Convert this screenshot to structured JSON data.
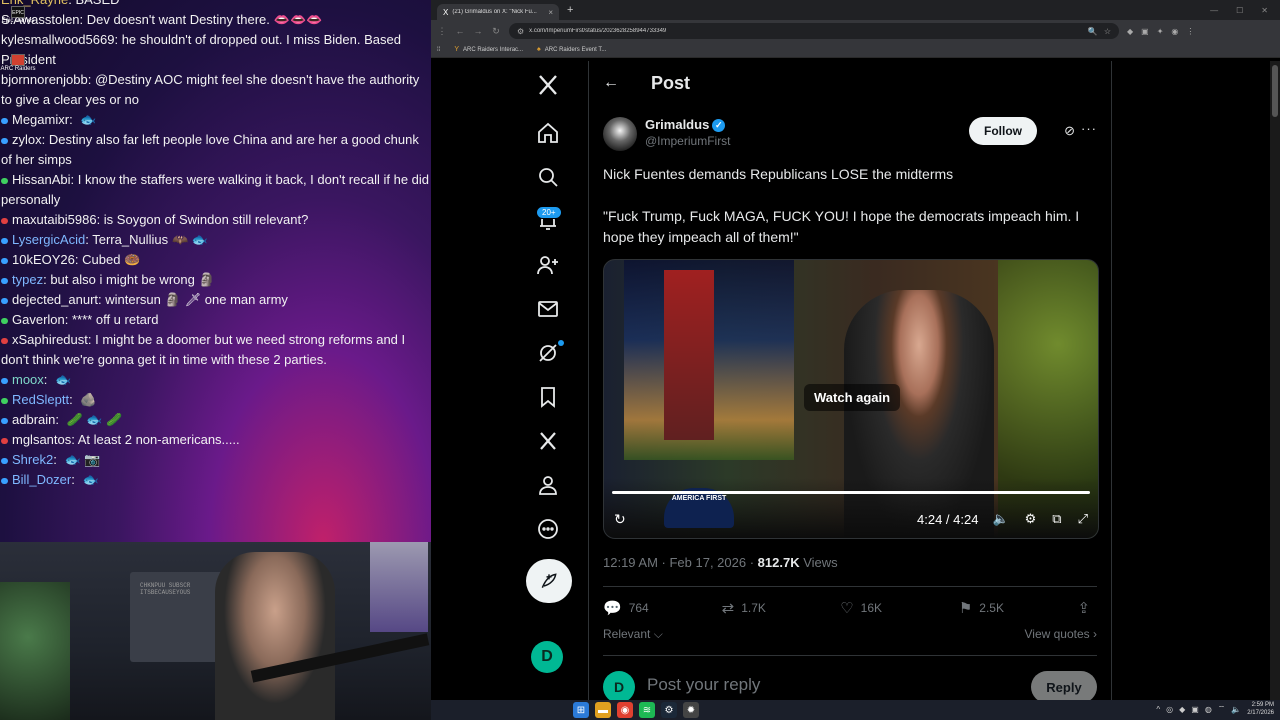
{
  "chat": {
    "desktop_icons": [
      "Epic Games",
      "ARC Raiders"
    ],
    "lines": [
      {
        "user": "Erik_Rayne",
        "sep": ": ",
        "msg": "BASED",
        "color": "#e0c060",
        "badge": "",
        "emote": ""
      },
      {
        "user": "S.Awasstolen",
        "sep": ": ",
        "msg": "Dev doesn't want Destiny there.",
        "color": "#f2f2f2",
        "badge": "",
        "emote": "👄👄👄"
      },
      {
        "user": "kylesmallwood5669",
        "sep": ": ",
        "msg": "he shouldn't of dropped out. I miss Biden. Based President",
        "color": "#f2f2f2",
        "badge": "",
        "emote": ""
      },
      {
        "user": "bjornnorenjobb",
        "sep": ": ",
        "msg": "@Destiny AOC might feel she doesn't have the authority to give a clear yes or no",
        "color": "#f2f2f2",
        "badge": "",
        "emote": ""
      },
      {
        "user": "Megamixr",
        "sep": ": ",
        "msg": "",
        "color": "#f2f2f2",
        "badge": "#39a0ff",
        "emote": "🐟"
      },
      {
        "user": "zylox",
        "sep": ": ",
        "msg": "Destiny also far left people love China and are her a good chunk of her simps",
        "color": "#f2f2f2",
        "badge": "#39a0ff",
        "emote": ""
      },
      {
        "user": "HissanAbi",
        "sep": ": ",
        "msg": "I know the staffers were walking it back, I don't recall if he did personally",
        "color": "#f2f2f2",
        "badge": "#3fd060",
        "emote": ""
      },
      {
        "user": "maxutaibi5986",
        "sep": ": ",
        "msg": "is Soygon of Swindon still relevant?",
        "color": "#f2f2f2",
        "badge": "#e04040",
        "emote": ""
      },
      {
        "user": "LysergicAcid",
        "sep": ": ",
        "msg": "Terra_Nullius",
        "color": "#7fb8ff",
        "badge": "#39a0ff",
        "emote": "🦇 🐟"
      },
      {
        "user": "10kEOY26",
        "sep": ": ",
        "msg": "Cubed",
        "color": "#f2f2f2",
        "badge": "#39a0ff",
        "emote": "🍩"
      },
      {
        "user": "typez",
        "sep": ": ",
        "msg": "but also i might be wrong",
        "color": "#7fb8ff",
        "badge": "#39a0ff",
        "emote": "🗿"
      },
      {
        "user": "dejected_anurt",
        "sep": ": ",
        "msg": "wintersun",
        "color": "#f2f2f2",
        "badge": "#39a0ff",
        "emote": "🗿 🗡 one man army"
      },
      {
        "user": "Gaverlon",
        "sep": ": ",
        "msg": "**** off u retard",
        "color": "#f2f2f2",
        "badge": "#3fd060",
        "emote": ""
      },
      {
        "user": "xSaphiredust",
        "sep": ": ",
        "msg": "I might be a doomer but we need strong reforms and I don't think we're gonna get it in time with these 2 parties.",
        "color": "#f2f2f2",
        "badge": "#e04040",
        "emote": ""
      },
      {
        "user": "moox",
        "sep": ": ",
        "msg": "",
        "color": "#7fd8c8",
        "badge": "#39a0ff",
        "emote": "🐟"
      },
      {
        "user": "RedSleptt",
        "sep": ": ",
        "msg": "",
        "color": "#7fb8ff",
        "badge": "#3fd060",
        "emote": "🪨"
      },
      {
        "user": "adbrain",
        "sep": ": ",
        "msg": "",
        "color": "#f2f2f2",
        "badge": "#39a0ff",
        "emote": "🥒 🐟 🥒"
      },
      {
        "user": "mglsantos",
        "sep": ": ",
        "msg": "At least 2 non-americans.....",
        "color": "#f2f2f2",
        "badge": "#e04040",
        "emote": ""
      },
      {
        "user": "Shrek2",
        "sep": ": ",
        "msg": "",
        "color": "#7fb8ff",
        "badge": "#39a0ff",
        "emote": "🐟 📷"
      },
      {
        "user": "Bill_Dozer",
        "sep": ": ",
        "msg": "",
        "color": "#7fb8ff",
        "badge": "#39a0ff",
        "emote": "🐟"
      }
    ]
  },
  "webcam": {
    "wall_text": "CHKNPUU SUBSCR\nITSBECAUSEYOUS"
  },
  "browser": {
    "tab_title": "(21) Grimaldus on X: \"Nick Fu...",
    "tab_favicon": "X",
    "new_tab": "+",
    "url": "x.com/ImperiumFirst/status/2023628258944733349",
    "bookmarks": [
      "ARC Raiders Interac...",
      "ARC Raiders Event T..."
    ]
  },
  "xnav": {
    "items": [
      "x-logo-icon",
      "home-icon",
      "explore-icon",
      "notifications-icon",
      "follow-icon",
      "messages-icon",
      "grok-icon",
      "bookmarks-icon",
      "premium-x-icon",
      "profile-icon",
      "more-icon"
    ],
    "notif_badge": "20+"
  },
  "post": {
    "header_title": "Post",
    "author_name": "Grimaldus",
    "author_handle": "@ImperiumFirst",
    "follow_label": "Follow",
    "text1": "Nick Fuentes demands Republicans LOSE the midterms",
    "text2": "\"Fuck Trump, Fuck MAGA, FUCK YOU! I hope the democrats impeach him. I hope they impeach all of them!\"",
    "video": {
      "watch_again": "Watch again",
      "timecode": "4:24 / 4:24",
      "cap_text": "AMERICA FIRST",
      "progress": 1.0
    },
    "time": "12:19 AM · Feb 17, 2026 · ",
    "views_count": "812.7K",
    "views_label": " Views",
    "replies": "764",
    "reposts": "1.7K",
    "likes": "16K",
    "bookmarks": "2.5K",
    "relevant_label": "Relevant ⌵",
    "view_quotes": "View quotes ›",
    "reply_placeholder": "Post your reply",
    "reply_button": "Reply"
  },
  "taskbar": {
    "clock_time": "2:59 PM",
    "clock_date": "2/17/2026"
  }
}
